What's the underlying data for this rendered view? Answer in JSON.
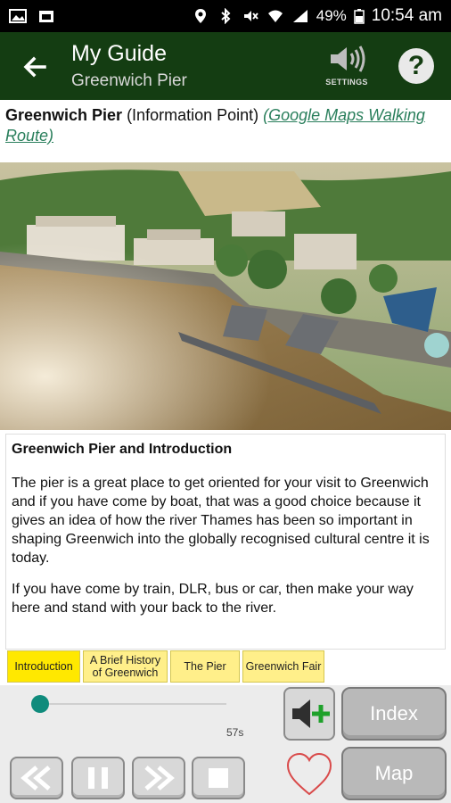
{
  "status_bar": {
    "battery": "49%",
    "time": "10:54 am"
  },
  "app_bar": {
    "title": "My Guide",
    "subtitle": "Greenwich Pier",
    "settings_label": "SETTINGS",
    "help_label": "?"
  },
  "info": {
    "place": "Greenwich Pier",
    "type": " (Information Point) ",
    "link": "(Google Maps Walking Route)"
  },
  "content": {
    "heading": "Greenwich Pier and Introduction",
    "para1": "The pier is a great place to get oriented for your visit to Greenwich and if you have come by boat, that was a good choice because it gives an idea of how the river Thames has been so important in shaping Greenwich into the globally recognised cultural centre it is today.",
    "para2": "If you have come by train, DLR, bus or car, then make your way here and stand with your back to the river."
  },
  "tabs": [
    {
      "label": "Introduction"
    },
    {
      "label": "A Brief History of Greenwich"
    },
    {
      "label": "The Pier"
    },
    {
      "label": "Greenwich Fair"
    }
  ],
  "player": {
    "progress": 0.04,
    "time_label": "57s"
  },
  "buttons": {
    "index": "Index",
    "map": "Map"
  },
  "colors": {
    "app_bar": "#143d12",
    "link": "#2a7f5c",
    "tab_active": "#ffe800",
    "tab": "#ffef8a",
    "slider": "#0f8b7c"
  }
}
